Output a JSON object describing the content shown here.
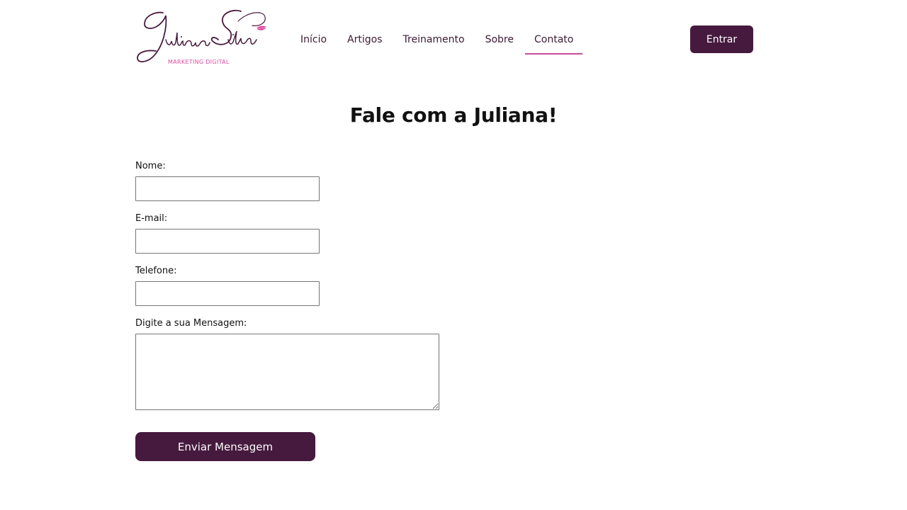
{
  "header": {
    "logo": {
      "wordmark": "Juliana Silva",
      "tagline": "MARKETING DIGITAL",
      "accent_color": "#e0409a",
      "ink_color": "#4a1b3f"
    },
    "nav": {
      "items": [
        {
          "label": "Início",
          "active": false
        },
        {
          "label": "Artigos",
          "active": false
        },
        {
          "label": "Treinamento",
          "active": false
        },
        {
          "label": "Sobre",
          "active": false
        },
        {
          "label": "Contato",
          "active": true
        }
      ],
      "active_underline_color": "#c94d97"
    },
    "login_button": "Entrar"
  },
  "main": {
    "title": "Fale com a Juliana!",
    "form": {
      "name": {
        "label": "Nome:",
        "value": ""
      },
      "email": {
        "label": "E-mail:",
        "value": ""
      },
      "phone": {
        "label": "Telefone:",
        "value": ""
      },
      "message": {
        "label": "Digite a sua Mensagem:",
        "value": ""
      },
      "submit_label": "Enviar Mensagem"
    }
  },
  "colors": {
    "primary": "#461a3e",
    "button_text": "#ffffff"
  }
}
